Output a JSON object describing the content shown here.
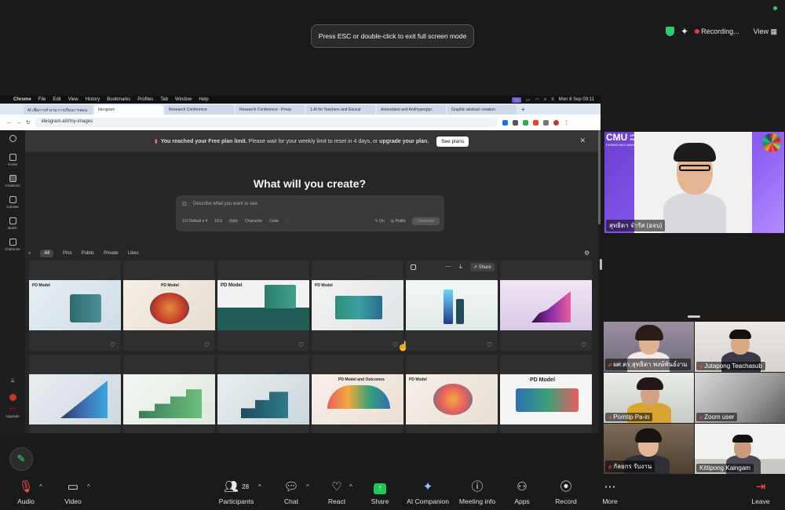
{
  "zoom": {
    "esc_banner": "Press ESC or double-click to exit full screen mode",
    "recording_label": "Recording...",
    "view_label": "View",
    "toolbar": {
      "audio": "Audio",
      "video": "Video",
      "participants": "Participants",
      "participants_count": "28",
      "chat": "Chat",
      "react": "React",
      "share": "Share",
      "ai_companion": "AI Companion",
      "meeting_info": "Meeting info",
      "apps": "Apps",
      "record": "Record",
      "more": "More",
      "leave": "Leave"
    },
    "participants": [
      {
        "name": "สุทธิดา จำรัส (อจบ)"
      },
      {
        "name": "ผศ.ดร.สุทธิดา พงษ์พันธ์งาม"
      },
      {
        "name": "Jutapong Teachasub"
      },
      {
        "name": "Porntip Pa-in"
      },
      {
        "name": "Zoom user"
      },
      {
        "name": "กัลยกร รับงาน"
      },
      {
        "name": "Kittipong Kaingam"
      }
    ],
    "logo_text": {
      "line1": "CMU",
      "line2": "UPSKILLS RESKILLS",
      "line3": "CHIANG MAI UNIVERSITY"
    }
  },
  "mac": {
    "menu": [
      "Chrome",
      "File",
      "Edit",
      "View",
      "History",
      "Bookmarks",
      "Profiles",
      "Tab",
      "Window",
      "Help"
    ],
    "clock": "Mon 8 Sep 09:11"
  },
  "browser": {
    "tabs": [
      "AI เพื่อการทำงาน การเรียนการสอน",
      "Ideogram",
      "Research Conference",
      "Research Conference - Prese",
      "1.AI for Teachers and Educat",
      "Antioxidant and Antihyperglyc",
      "Graphic abstract creation"
    ],
    "url": "ideogram.ai/t/my-images"
  },
  "ideogram": {
    "sidebar": [
      "Home",
      "Creations",
      "Canvas",
      "Batch",
      "Character"
    ],
    "upgrade": "Upgrade",
    "credits": "0",
    "notice_prefix": "You reached your Free plan limit.",
    "notice_middle": " Please wait for your weekly limit to reset in 4 days, or ",
    "notice_link": "upgrade your plan.",
    "see_plans": "See plans",
    "headline": "What will you create?",
    "prompt_placeholder": "Describe what you want to see",
    "prompt_options": [
      "3.0 Default x 4",
      "16:9",
      "Style",
      "Character",
      "Color"
    ],
    "prompt_on": "On",
    "prompt_public": "Public",
    "generate": "Generate",
    "filters": [
      "All",
      "Pins",
      "Public",
      "Private",
      "Likes"
    ],
    "share": "Share",
    "cards_row1": [
      "PD Model",
      "PD Model",
      "PD Model",
      "PD Model",
      "",
      ""
    ],
    "cards_row2": [
      "",
      "",
      "",
      "PD Model and Outcomes",
      "PD Model",
      "PD Model"
    ]
  }
}
